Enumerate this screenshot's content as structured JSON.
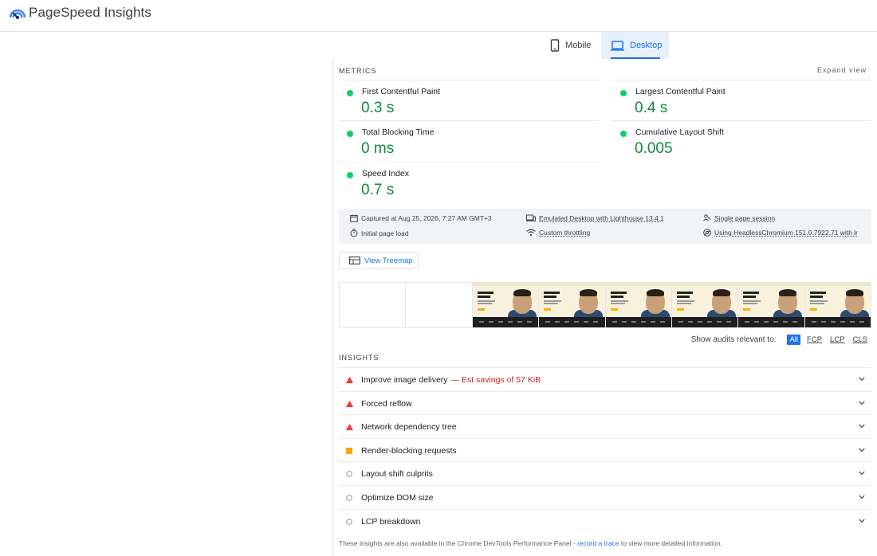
{
  "header": {
    "title": "PageSpeed Insights"
  },
  "tabs": [
    {
      "label": "Mobile"
    },
    {
      "label": "Desktop"
    }
  ],
  "metrics_section": {
    "label": "METRICS",
    "expand_label": "Expand view",
    "items": [
      {
        "name": "First Contentful Paint",
        "value": "0.3 s"
      },
      {
        "name": "Largest Contentful Paint",
        "value": "0.4 s"
      },
      {
        "name": "Total Blocking Time",
        "value": "0 ms"
      },
      {
        "name": "Cumulative Layout Shift",
        "value": "0.005"
      },
      {
        "name": "Speed Index",
        "value": "0.7 s"
      }
    ],
    "status_color": "#0cce6b",
    "value_color": "#0c8a3c"
  },
  "info": {
    "captured": "Captured at Aug 25, 2026, 7:27 AM GMT+3",
    "emulated": "Emulated Desktop with Lighthouse 13.4.1",
    "session": "Single page session",
    "load": "Initial page load",
    "throttling": "Custom throttling",
    "browser": "Using HeadlessChromium 151.0.7922.71 with lr"
  },
  "treemap": {
    "label": "View Treemap"
  },
  "filmstrip": {
    "frames": 8,
    "blank_frames": 2,
    "screenshot_text": [
      "Hi, I'm Adnan",
      "Beore"
    ]
  },
  "audit_filter": {
    "label": "Show audits relevant to:",
    "options": [
      "All",
      "FCP",
      "LCP",
      "CLS"
    ],
    "selected": "All"
  },
  "insights_section": {
    "label": "INSIGHTS",
    "items": [
      {
        "name": "Improve image delivery",
        "savings": "— Est savings of 57 KiB",
        "severity": "fail"
      },
      {
        "name": "Forced reflow",
        "savings": "",
        "severity": "fail"
      },
      {
        "name": "Network dependency tree",
        "savings": "",
        "severity": "fail"
      },
      {
        "name": "Render-blocking requests",
        "savings": "",
        "severity": "average"
      },
      {
        "name": "Layout shift culprits",
        "savings": "",
        "severity": "info"
      },
      {
        "name": "Optimize DOM size",
        "savings": "",
        "severity": "info"
      },
      {
        "name": "LCP breakdown",
        "savings": "",
        "severity": "info"
      }
    ],
    "colors": {
      "fail": "#f33",
      "average": "#ffa400",
      "info": "#9aa0a6"
    }
  },
  "footer": {
    "before": "These insights are also available in the Chrome DevTools Performance Panel - ",
    "link": "record a trace",
    "after": " to view more detailed information."
  }
}
